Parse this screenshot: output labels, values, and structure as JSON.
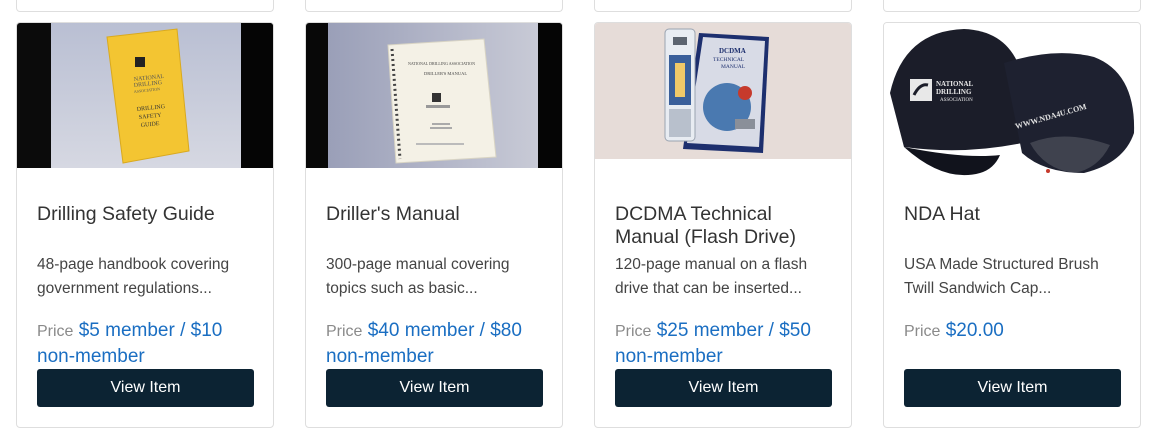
{
  "products": [
    {
      "title": "Drilling Safety Guide",
      "description": "48-page handbook covering government regulations...",
      "price_label": "Price",
      "price": "$5 member / $10 non-member",
      "button": "View Item",
      "image_text": [
        "NATIONAL",
        "DRILLING",
        "ASSOCIATION",
        "DRILLING",
        "SAFETY",
        "GUIDE"
      ]
    },
    {
      "title": "Driller's Manual",
      "description": "300-page manual covering topics such as basic...",
      "price_label": "Price",
      "price": "$40 member / $80 non-member",
      "button": "View Item",
      "image_text": [
        "NATIONAL DRILLING ASSOCIATION",
        "DRILLER'S MANUAL"
      ]
    },
    {
      "title": "DCDMA Technical Manual (Flash Drive)",
      "description": "120-page manual on a flash drive that can be inserted...",
      "price_label": "Price",
      "price": "$25 member / $50 non-member",
      "button": "View Item",
      "image_text": [
        "DCDMA",
        "TECHNICAL",
        "MANUAL"
      ]
    },
    {
      "title": "NDA Hat",
      "description": "USA Made Structured Brush Twill Sandwich Cap...",
      "price_label": "Price",
      "price": "$20.00",
      "button": "View Item",
      "image_text": [
        "NATIONAL",
        "DRILLING",
        "ASSOCIATION",
        "WWW.NDA4U.COM"
      ]
    }
  ]
}
